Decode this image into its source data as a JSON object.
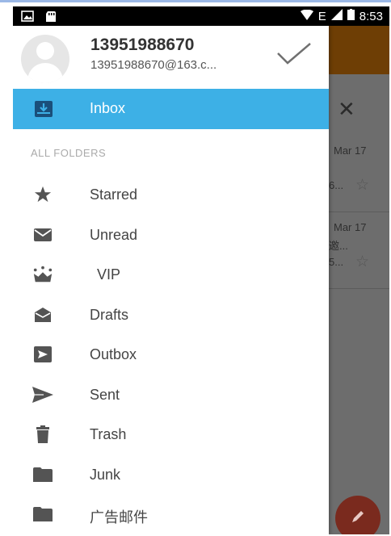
{
  "status_bar": {
    "network_label": "E",
    "time": "8:53"
  },
  "account": {
    "name": "13951988670",
    "email": "13951988670@163.c..."
  },
  "inbox": {
    "label": "Inbox"
  },
  "section_title": "ALL FOLDERS",
  "folders": [
    {
      "label": "Starred",
      "icon": "star-icon"
    },
    {
      "label": "Unread",
      "icon": "envelope-icon"
    },
    {
      "label": "VIP",
      "icon": "crown-icon"
    },
    {
      "label": "Drafts",
      "icon": "drafts-icon"
    },
    {
      "label": "Outbox",
      "icon": "outbox-icon"
    },
    {
      "label": "Sent",
      "icon": "send-icon"
    },
    {
      "label": "Trash",
      "icon": "trash-icon"
    },
    {
      "label": "Junk",
      "icon": "folder-icon"
    },
    {
      "label": "广告邮件",
      "icon": "folder-icon"
    }
  ],
  "background_list": [
    {
      "date": "Mar 17",
      "snippet": "6..."
    },
    {
      "date": "Mar 17",
      "snippet": "5...",
      "snippet_top": "邀..."
    }
  ],
  "colors": {
    "accent": "#3db0e6",
    "header_brand": "#b35c00",
    "fab": "#c0392b"
  }
}
